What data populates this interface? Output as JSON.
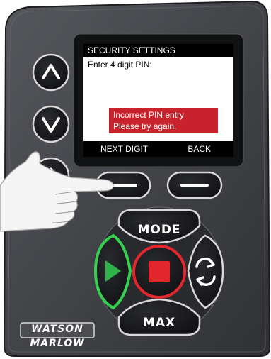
{
  "screen": {
    "header": "SECURITY SETTINGS",
    "prompt": "Enter 4 digit PIN:",
    "error_lines": [
      "Incorrect PIN entry",
      "Please try again."
    ],
    "softkey_left": "NEXT DIGIT",
    "softkey_right": "BACK"
  },
  "buttons": {
    "mode": "MODE",
    "max": "MAX"
  },
  "brand": {
    "line1": "WATSON",
    "line2": "MARLOW"
  },
  "colors": {
    "panel": "#3b3d42",
    "panel_light": "#5a5c61",
    "key": "#1b1c1f",
    "key_outline": "#d8d8d8",
    "start_green": "#2fb24a",
    "stop_red": "#e3262c",
    "error_red": "#c8232c"
  },
  "icons": [
    "up-arrow-icon",
    "down-arrow-icon",
    "home-icon",
    "play-icon",
    "stop-icon",
    "reverse-icon"
  ]
}
